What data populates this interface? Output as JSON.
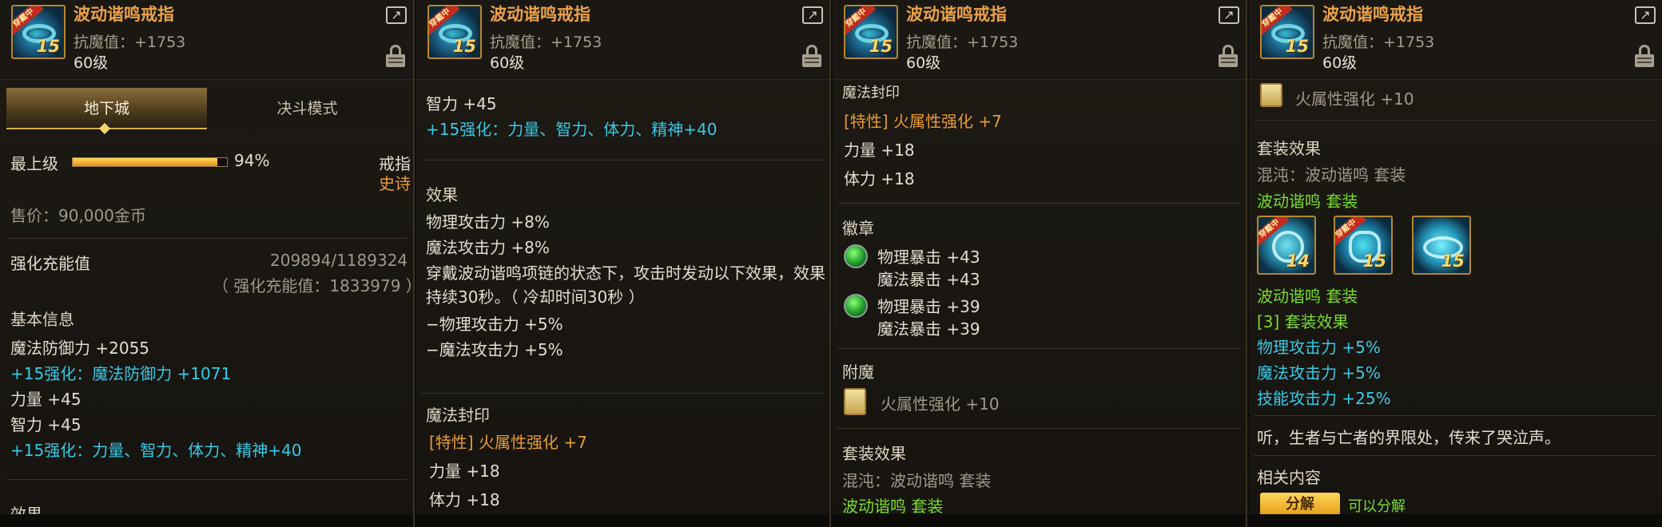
{
  "item": {
    "name": "波动谐鸣戒指",
    "attribute": "抗魔值：+1753",
    "level": "60级",
    "icon_badge": "穿戴中",
    "icon_number": "15"
  },
  "panel1": {
    "tabs": [
      "地下城",
      "决斗模式"
    ],
    "grade_label": "最上级",
    "grade_progress": 0.94,
    "grade_percent": "94%",
    "type": "戒指",
    "rarity": "史诗",
    "price": "售价：90,000金币",
    "charge_label": "强化充能值",
    "charge_value": "209894/1189324",
    "charge_total": "（ 强化充能值：1833979 ）",
    "basic_title": "基本信息",
    "basic_lines": [
      "魔法防御力 +2055",
      "+15强化：魔法防御力 +1071",
      "力量 +45",
      "智力 +45",
      "+15强化：力量、智力、体力、精神+40"
    ],
    "next_title": "效果"
  },
  "panel2": {
    "top_lines": [
      "智力 +45",
      "+15强化：力量、智力、体力、精神+40"
    ],
    "effect_title": "效果",
    "effect_lines": [
      "物理攻击力 +8%",
      "魔法攻击力 +8%",
      "穿戴波动谐鸣项链的状态下，攻击时发动以下效果，效果",
      "持续30秒。（ 冷却时间30秒 ）",
      "−物理攻击力 +5%",
      "−魔法攻击力 +5%"
    ],
    "seal_title": "魔法封印",
    "seal_lines": [
      "[特性] 火属性强化 +7",
      "力量 +18",
      "体力 +18"
    ]
  },
  "panel3": {
    "seal_title": "魔法封印",
    "seal_lines": [
      "[特性] 火属性强化 +7",
      "力量 +18",
      "体力 +18"
    ],
    "emblem_title": "徽章",
    "emblems": [
      {
        "line1": "物理暴击 +43",
        "line2": "魔法暴击 +43"
      },
      {
        "line1": "物理暴击 +39",
        "line2": "魔法暴击 +39"
      }
    ],
    "enchant_title": "附魔",
    "enchant_value": "火属性强化 +10",
    "set_title": "套装效果",
    "set_name": "混沌：波动谐鸣 套装",
    "set_sub": "波动谐鸣 套装"
  },
  "panel4": {
    "enchant_value": "火属性强化 +10",
    "set_title": "套装效果",
    "set_name": "混沌：波动谐鸣 套装",
    "set_sub1": "波动谐鸣 套装",
    "set_icons": [
      {
        "badge": "穿戴中",
        "number": "14"
      },
      {
        "badge": "穿戴中",
        "number": "15"
      },
      {
        "badge": "",
        "number": "15"
      }
    ],
    "set_sub2": "波动谐鸣 套装",
    "set_bonus_title": "[3] 套装效果",
    "set_bonus_lines": [
      "物理攻击力 +5%",
      "魔法攻击力 +5%",
      "技能攻击力 +25%"
    ],
    "flavor": "听，生者与亡者的界限处，传来了哭泣声。",
    "related_title": "相关内容",
    "decompose_button": "分解",
    "decompose_note": "可以分解"
  },
  "icons": {
    "share": "share-icon",
    "lock": "lock-icon",
    "gem": "gem-icon",
    "card": "card-icon"
  },
  "colors": {
    "name": "#e9a24a",
    "cyan": "#35c9e7",
    "green": "#78dd2e",
    "gold": "#e89b30"
  }
}
